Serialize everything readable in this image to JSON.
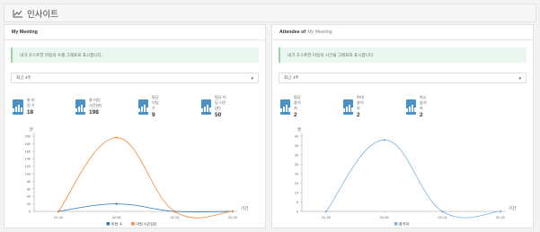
{
  "header": {
    "title": "인사이트"
  },
  "left": {
    "title_strong": "My Meeting",
    "title_rest": "",
    "alert": "내가 호스트한 미팅의 수를 그래프로 표시합니다.",
    "select": "최근 4주",
    "stats": [
      {
        "label": "총 미팅 수",
        "value": "18"
      },
      {
        "label": "총 미팅 시간(분)",
        "value": "198"
      },
      {
        "label": "평균 미팅 수",
        "value": "9"
      },
      {
        "label": "평균 미팅 시간(분)",
        "value": "50"
      }
    ]
  },
  "right": {
    "title_strong": "Attendee of",
    "title_rest": "My Meeting",
    "alert": "내가 호스트한 미팅의 시간을 그래프로 표시합니다.",
    "select": "최근 4주",
    "stats": [
      {
        "label": "평균 참석자",
        "value": "2"
      },
      {
        "label": "최대 참석자",
        "value": "2"
      },
      {
        "label": "최소 참석자",
        "value": "2"
      }
    ]
  },
  "chart_data": [
    {
      "type": "line",
      "ylabel": "분",
      "xlabel": "기간",
      "x": [
        "01-30",
        "02-06",
        "02-13",
        "02-20"
      ],
      "ylim": [
        0,
        200
      ],
      "yticks": [
        0,
        20,
        40,
        60,
        80,
        100,
        120,
        140,
        160,
        180,
        200
      ],
      "series": [
        {
          "name": "미팅 수",
          "color": "#2a7ab8",
          "values": [
            0,
            20,
            0,
            0
          ]
        },
        {
          "name": "미팅 시간(분)",
          "color": "#f08a3c",
          "values": [
            0,
            196,
            0,
            0
          ]
        }
      ]
    },
    {
      "type": "line",
      "ylabel": "명",
      "xlabel": "기간",
      "x": [
        "01-30",
        "02-06",
        "02-13",
        "02-20"
      ],
      "ylim": [
        0,
        40
      ],
      "yticks": [
        0,
        5,
        10,
        15,
        20,
        25,
        30,
        35,
        40
      ],
      "series": [
        {
          "name": "참석자",
          "color": "#7fb3dc",
          "values": [
            0,
            38,
            0,
            0
          ]
        }
      ]
    }
  ]
}
